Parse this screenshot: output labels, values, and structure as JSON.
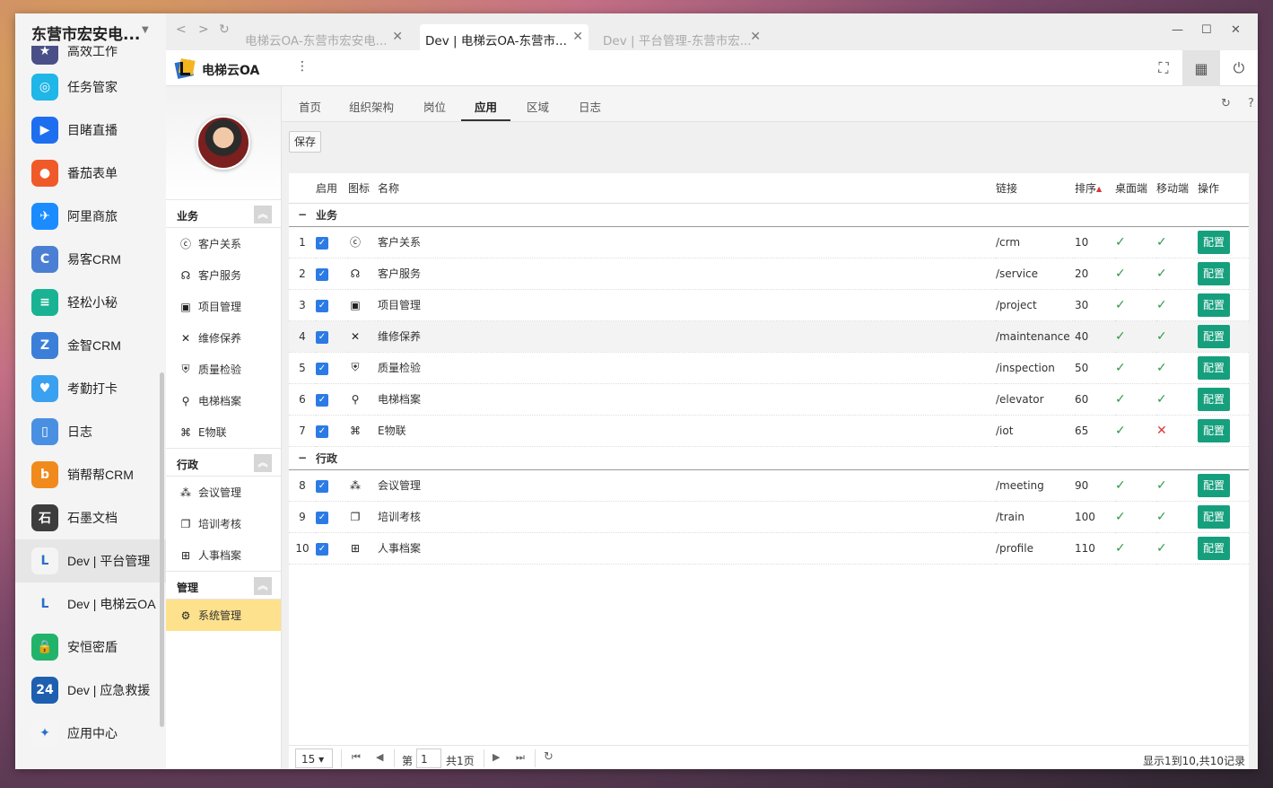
{
  "apps": {
    "title": "东营市宏安电...",
    "items": [
      {
        "label": "高效工作",
        "icon": "star-icon",
        "color": "#4b4f87",
        "glyph": "★"
      },
      {
        "label": "任务管家",
        "icon": "task-icon",
        "color": "#1fb6e8",
        "glyph": "◎"
      },
      {
        "label": "目睹直播",
        "icon": "play-icon",
        "color": "#1e6ff0",
        "glyph": "▶"
      },
      {
        "label": "番茄表单",
        "icon": "tomato-icon",
        "color": "#f05a28",
        "glyph": "●"
      },
      {
        "label": "阿里商旅",
        "icon": "plane-icon",
        "color": "#1a8cff",
        "glyph": "✈"
      },
      {
        "label": "易客CRM",
        "icon": "crm-icon",
        "color": "#4a7fd4",
        "glyph": "C"
      },
      {
        "label": "轻松小秘",
        "icon": "notes-icon",
        "color": "#19b394",
        "glyph": "≡"
      },
      {
        "label": "金智CRM",
        "icon": "chart-icon",
        "color": "#3b7fd9",
        "glyph": "Z"
      },
      {
        "label": "考勤打卡",
        "icon": "location-icon",
        "color": "#3aa0f0",
        "glyph": "♥"
      },
      {
        "label": "日志",
        "icon": "log-icon",
        "color": "#4a90e2",
        "glyph": "▯"
      },
      {
        "label": "销帮帮CRM",
        "icon": "b-icon",
        "color": "#f08a1c",
        "glyph": "b"
      },
      {
        "label": "石墨文档",
        "icon": "doc-icon",
        "color": "#3d3d3d",
        "glyph": "石"
      },
      {
        "label": "Dev | 平台管理",
        "icon": "elevator-logo-icon",
        "color": "#f4f4f4",
        "glyph": "L"
      },
      {
        "label": "Dev | 电梯云OA",
        "icon": "elevator-logo-icon",
        "color": "#f4f4f4",
        "glyph": "L"
      },
      {
        "label": "安恒密盾",
        "icon": "lock-icon",
        "color": "#22b36a",
        "glyph": "🔒"
      },
      {
        "label": "Dev | 应急救援",
        "icon": "emergency-icon",
        "color": "#1e5fb0",
        "glyph": "24"
      },
      {
        "label": "应用中心",
        "icon": "appcenter-icon",
        "color": "#f5f5f5",
        "glyph": "✦"
      }
    ]
  },
  "browser": {
    "tabs": [
      {
        "label": "电梯云OA-东营市宏安电..."
      },
      {
        "label": "Dev | 电梯云OA-东营市..."
      },
      {
        "label": "Dev | 平台管理-东营市宏..."
      }
    ]
  },
  "header": {
    "app_name": "电梯云OA"
  },
  "nav": {
    "groups": [
      {
        "title": "业务",
        "items": [
          {
            "label": "客户关系",
            "glyph": "ⓒ",
            "icon": "crm-icon"
          },
          {
            "label": "客户服务",
            "glyph": "☊",
            "icon": "headset-icon"
          },
          {
            "label": "项目管理",
            "glyph": "▣",
            "icon": "project-icon"
          },
          {
            "label": "维修保养",
            "glyph": "✕",
            "icon": "tools-icon"
          },
          {
            "label": "质量检验",
            "glyph": "⛨",
            "icon": "shield-icon"
          },
          {
            "label": "电梯档案",
            "glyph": "⚲",
            "icon": "escalator-icon"
          },
          {
            "label": "E物联",
            "glyph": "⌘",
            "icon": "iot-icon"
          }
        ]
      },
      {
        "title": "行政",
        "items": [
          {
            "label": "会议管理",
            "glyph": "⁂",
            "icon": "meeting-icon"
          },
          {
            "label": "培训考核",
            "glyph": "❐",
            "icon": "training-icon"
          },
          {
            "label": "人事档案",
            "glyph": "⊞",
            "icon": "profile-icon"
          }
        ]
      },
      {
        "title": "管理",
        "items": [
          {
            "label": "系统管理",
            "glyph": "⚙",
            "icon": "gears-icon"
          }
        ]
      }
    ]
  },
  "main": {
    "tabs": [
      "首页",
      "组织架构",
      "岗位",
      "应用",
      "区域",
      "日志"
    ],
    "active_tab": "应用",
    "save_label": "保存",
    "columns": {
      "enable": "启用",
      "icon": "图标",
      "name": "名称",
      "link": "链接",
      "sort": "排序",
      "desktop": "桌面端",
      "mobile": "移动端",
      "action": "操作"
    },
    "groups": [
      {
        "title": "业务",
        "rows": [
          {
            "no": "1",
            "glyph": "ⓒ",
            "icon": "crm-icon",
            "name": "客户关系",
            "link": "/crm",
            "sort": "10",
            "desktop": true,
            "mobile": true
          },
          {
            "no": "2",
            "glyph": "☊",
            "icon": "headset-icon",
            "name": "客户服务",
            "link": "/service",
            "sort": "20",
            "desktop": true,
            "mobile": true
          },
          {
            "no": "3",
            "glyph": "▣",
            "icon": "project-icon",
            "name": "项目管理",
            "link": "/project",
            "sort": "30",
            "desktop": true,
            "mobile": true
          },
          {
            "no": "4",
            "glyph": "✕",
            "icon": "tools-icon",
            "name": "维修保养",
            "link": "/maintenance",
            "sort": "40",
            "desktop": true,
            "mobile": true,
            "highlight": true
          },
          {
            "no": "5",
            "glyph": "⛨",
            "icon": "shield-icon",
            "name": "质量检验",
            "link": "/inspection",
            "sort": "50",
            "desktop": true,
            "mobile": true
          },
          {
            "no": "6",
            "glyph": "⚲",
            "icon": "escalator-icon",
            "name": "电梯档案",
            "link": "/elevator",
            "sort": "60",
            "desktop": true,
            "mobile": true
          },
          {
            "no": "7",
            "glyph": "⌘",
            "icon": "iot-icon",
            "name": "E物联",
            "link": "/iot",
            "sort": "65",
            "desktop": true,
            "mobile": false
          }
        ]
      },
      {
        "title": "行政",
        "rows": [
          {
            "no": "8",
            "glyph": "⁂",
            "icon": "meeting-icon",
            "name": "会议管理",
            "link": "/meeting",
            "sort": "90",
            "desktop": true,
            "mobile": true
          },
          {
            "no": "9",
            "glyph": "❐",
            "icon": "training-icon",
            "name": "培训考核",
            "link": "/train",
            "sort": "100",
            "desktop": true,
            "mobile": true
          },
          {
            "no": "10",
            "glyph": "⊞",
            "icon": "profile-icon",
            "name": "人事档案",
            "link": "/profile",
            "sort": "110",
            "desktop": true,
            "mobile": true
          }
        ]
      }
    ],
    "config_label": "配置"
  },
  "pager": {
    "page_size": "15",
    "page_prefix": "第",
    "page_value": "1",
    "page_suffix": "共1页",
    "summary": "显示1到10,共10记录"
  },
  "colors": {
    "accent": "#169f7d",
    "checkbox": "#2c7be5",
    "ok": "#2e9a4a",
    "no": "#d9373b",
    "active_nav": "#fde18c"
  }
}
